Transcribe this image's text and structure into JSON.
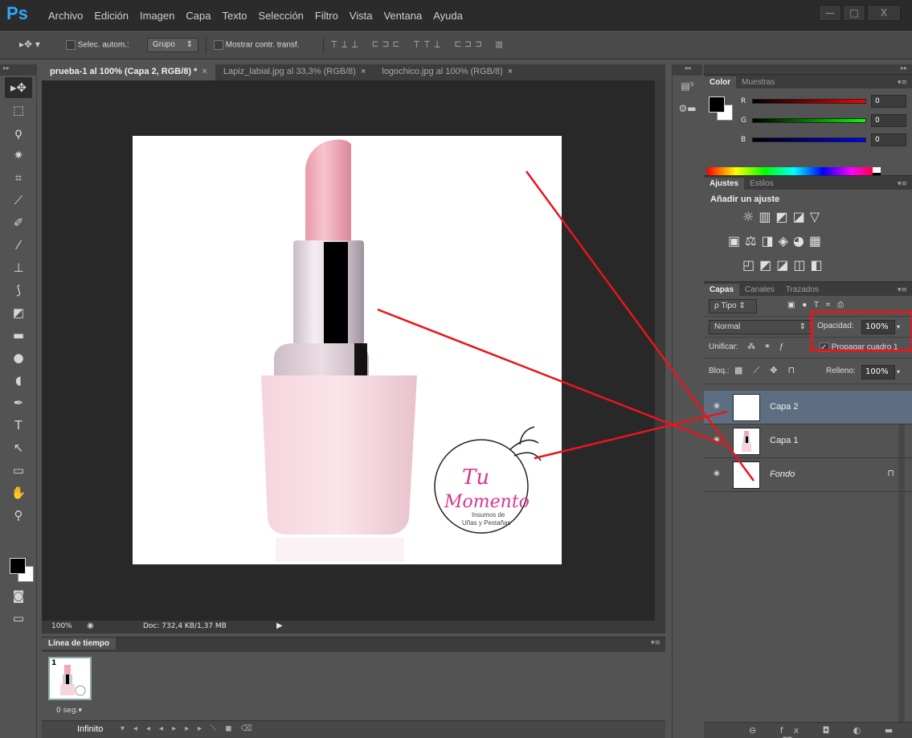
{
  "app": {
    "logo": "Ps"
  },
  "menu": [
    "Archivo",
    "Edición",
    "Imagen",
    "Capa",
    "Texto",
    "Selección",
    "Filtro",
    "Vista",
    "Ventana",
    "Ayuda"
  ],
  "window_controls": {
    "minimize": "—",
    "maximize": "□",
    "close": "X"
  },
  "options_bar": {
    "auto_select_label": "Selec. autom.:",
    "group_value": "Grupo",
    "show_transform_label": "Mostrar contr. transf.",
    "align_icons": "⊤⊥⊥ ⊏⊐⊏ ⊤⊤⊥ ⊏⊐⊐ ▥"
  },
  "tabs": [
    {
      "label": "prueba-1 al 100% (Capa 2, RGB/8) *",
      "active": true
    },
    {
      "label": "Lapiz_labial.jpg al 33,3% (RGB/8)",
      "active": false
    },
    {
      "label": "logochico.jpg al 100% (RGB/8)",
      "active": false
    }
  ],
  "status": {
    "zoom": "100%",
    "doc": "Doc: 732,4 KB/1,37 MB"
  },
  "timeline": {
    "title": "Línea de tiempo",
    "frame_number": "1",
    "frame_delay": "0 seg.▾",
    "loop": "Infinito"
  },
  "canvas_logo": {
    "line1": "Tu",
    "line2": "Momento",
    "sub1": "Insumos de",
    "sub2": "Uñas y Pestañas"
  },
  "color_panel": {
    "tabs": [
      "Color",
      "Muestras"
    ],
    "channels": [
      {
        "label": "R",
        "value": "0"
      },
      {
        "label": "G",
        "value": "0"
      },
      {
        "label": "B",
        "value": "0"
      }
    ]
  },
  "adjustments_panel": {
    "tabs": [
      "Ajustes",
      "Estilos"
    ],
    "title": "Añadir un ajuste",
    "row1": "☼▥◩◪▽",
    "row2": "▣⚖◨◈◕▦",
    "row3": "◰◩◪◫◧"
  },
  "layers_panel": {
    "tabs": [
      "Capas",
      "Canales",
      "Trazados"
    ],
    "filter": "ρ Tipo",
    "filter_icons": "▣ ● T ⌗ ⎙",
    "blend_mode": "Normal",
    "opacity_label": "Opacidad:",
    "opacity_value": "100%",
    "unify_label": "Unificar:",
    "propagate_label": "Propagar cuadro 1",
    "lock_label": "Bloq.:",
    "fill_label": "Relleno:",
    "fill_value": "100%",
    "layers": [
      {
        "name": "Capa 2",
        "selected": true
      },
      {
        "name": "Capa 1",
        "selected": false
      },
      {
        "name": "Fondo",
        "selected": false,
        "locked": true
      }
    ],
    "footer": "⊖ fx ◘ ◐ ▬ ◼ ⌫"
  },
  "colors": {
    "accent": "#31a8ff",
    "annotation": "#e8161b",
    "selected_layer": "#5e6e82"
  }
}
